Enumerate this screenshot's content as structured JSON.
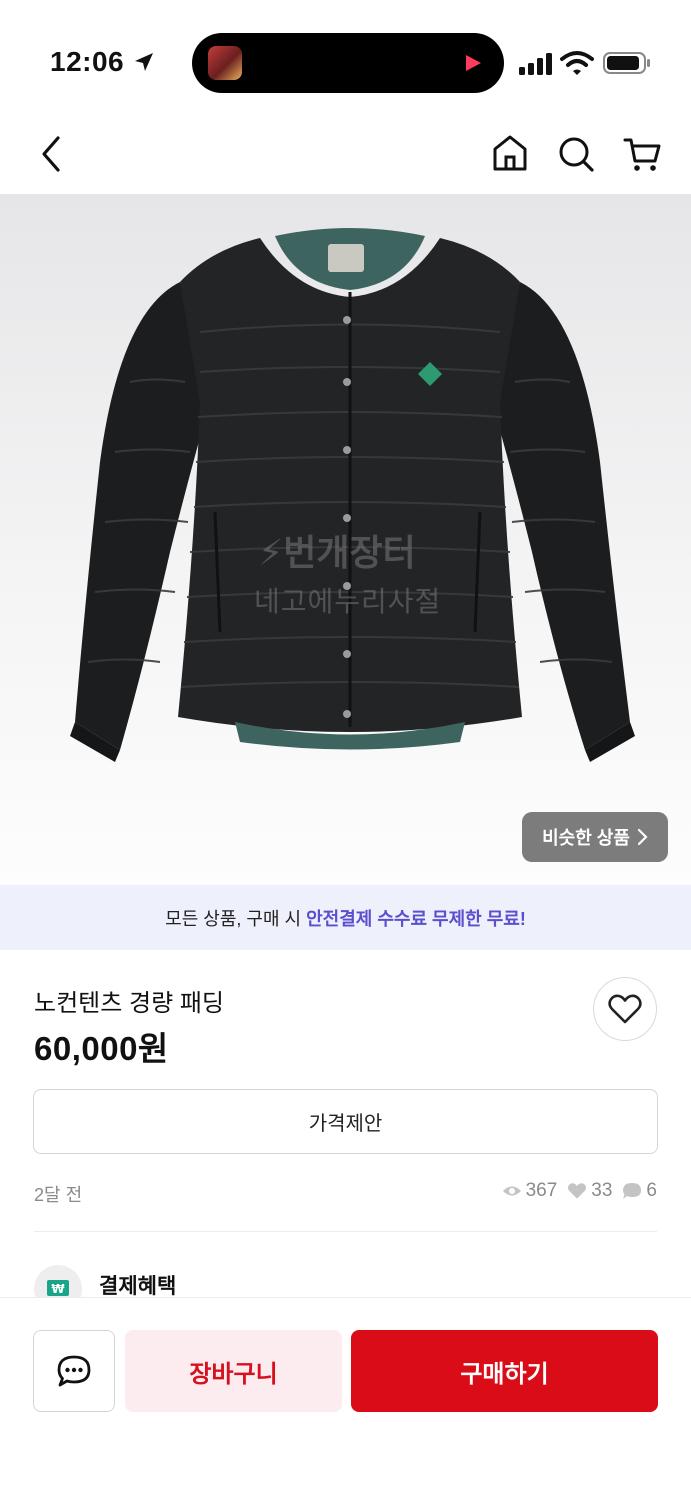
{
  "status_bar": {
    "time": "12:06",
    "icons": [
      "location-arrow-icon",
      "play-icon",
      "cellular-signal-icon",
      "wifi-icon",
      "battery-icon"
    ]
  },
  "nav": {
    "icons": [
      "back-chevron-icon",
      "home-icon",
      "search-icon",
      "cart-icon"
    ]
  },
  "product_image": {
    "watermark_brand": "번개장터",
    "watermark_seller": "네고에누리사절",
    "similar_button_label": "비슷한 상품"
  },
  "banner": {
    "prefix": "모든 상품, 구매 시 ",
    "highlight": "안전결제 수수료 무제한 무료!",
    "highlight_color": "#5a4fcf"
  },
  "product": {
    "title": "노컨텐츠 경량 패딩",
    "price": "60,000원",
    "offer_button_label": "가격제안",
    "posted_ago": "2달 전",
    "views": "367",
    "likes": "33",
    "chats": "6"
  },
  "benefits": {
    "label": "결제혜택",
    "icon_text": "₩",
    "icon_color": "#1aa58a"
  },
  "bottom_bar": {
    "cart_button_label": "장바구니",
    "buy_button_label": "구매하기",
    "accent_color": "#d90c18"
  }
}
